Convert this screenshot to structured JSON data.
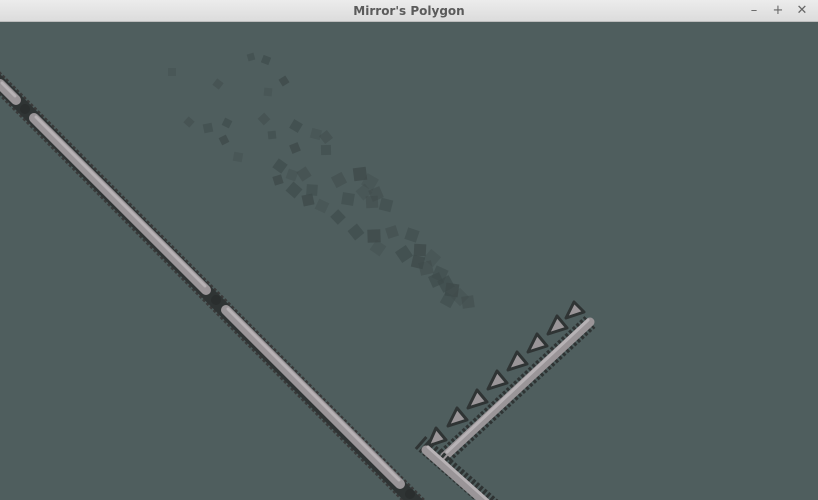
{
  "window": {
    "title": "Mirror's Polygon",
    "controls": {
      "minimize": "–",
      "maximize": "+",
      "close": "✕"
    }
  },
  "scene": {
    "background": "#4f5e5e",
    "rail_fill": "#9a9598",
    "rail_highlight": "#b7b2b5",
    "rail_outline": "#3a3a3a",
    "particle_color": "#3e4a4a"
  }
}
